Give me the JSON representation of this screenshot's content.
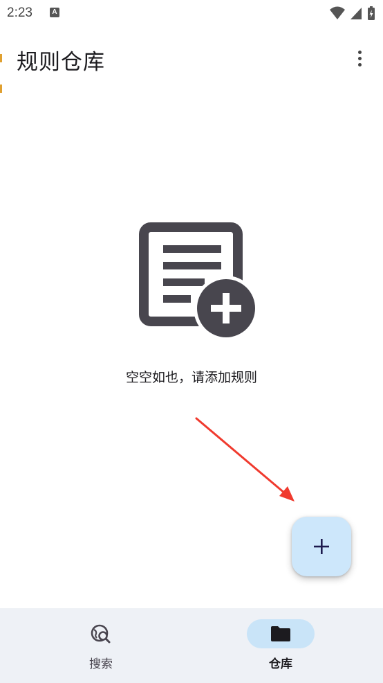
{
  "status_bar": {
    "time": "2:23",
    "notification_icon_text": "A"
  },
  "app_bar": {
    "title": "规则仓库"
  },
  "empty_state": {
    "message": "空空如也，请添加规则"
  },
  "bottom_nav": {
    "items": [
      {
        "label": "搜索",
        "icon": "globe-search-icon",
        "selected": false
      },
      {
        "label": "仓库",
        "icon": "folder-icon",
        "selected": true
      }
    ]
  },
  "colors": {
    "fab_background": "#cde7fb",
    "nav_background": "#eef1f6",
    "nav_selected_indicator": "#c9e4f8",
    "illustration": "#48464e",
    "annotation_arrow": "#f03a2e"
  }
}
